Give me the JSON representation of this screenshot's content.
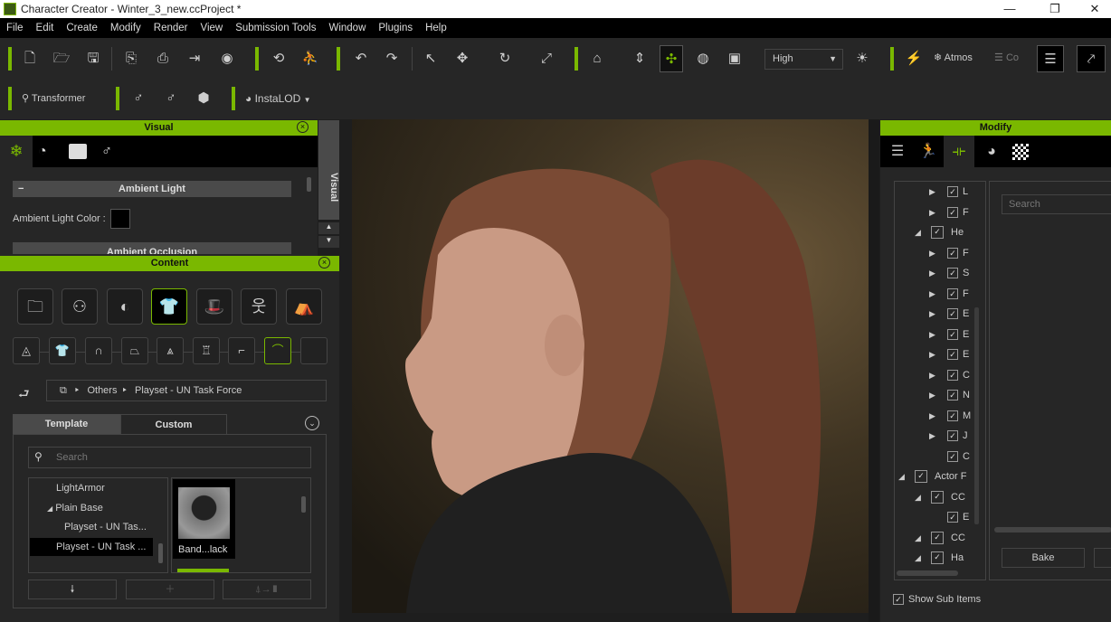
{
  "window": {
    "title": "Character Creator - Winter_3_new.ccProject *",
    "minimize": "—",
    "maximize": "❐",
    "close": "✕"
  },
  "menu": [
    "File",
    "Edit",
    "Create",
    "Modify",
    "Render",
    "View",
    "Submission Tools",
    "Window",
    "Plugins",
    "Help"
  ],
  "toolbar": {
    "quality_select": "High",
    "atmos_label": "Atmos",
    "co_label": "Co",
    "transformer_label": "Transformer",
    "instalod_label": "InstaLOD"
  },
  "colors": {
    "accent": "#7ab800",
    "panel": "#262626",
    "menubar": "#000000"
  },
  "visual_panel": {
    "title": "Visual",
    "side_tab": "Visual",
    "section1": "Ambient Light",
    "color_label": "Ambient Light Color :",
    "ambient_color": "#000000",
    "section2": "Ambient Occlusion"
  },
  "content_panel": {
    "title": "Content",
    "breadcrumb": [
      "Others",
      "Playset - UN Task Force"
    ],
    "tabs": [
      "Template",
      "Custom"
    ],
    "active_tab": "Template",
    "search_placeholder": "Search",
    "tree": [
      {
        "label": "LightArmor",
        "level": 1
      },
      {
        "label": "Plain Base",
        "level": 1,
        "expanded": true
      },
      {
        "label": "Playset - UN Tas...",
        "level": 2
      },
      {
        "label": "Playset - UN Task ...",
        "level": 1,
        "selected": true
      }
    ],
    "thumbnail_label": "Band...lack"
  },
  "modify_panel": {
    "title": "Modify",
    "search_placeholder": "Search",
    "bake_label": "Bake",
    "show_sub_items": "Show Sub Items",
    "tree": [
      {
        "label": "L",
        "level": 3
      },
      {
        "label": "F",
        "level": 3
      },
      {
        "label": "He",
        "level": 2
      },
      {
        "label": "F",
        "level": 3
      },
      {
        "label": "S",
        "level": 3
      },
      {
        "label": "F",
        "level": 3
      },
      {
        "label": "E",
        "level": 3
      },
      {
        "label": "E",
        "level": 3
      },
      {
        "label": "E",
        "level": 3
      },
      {
        "label": "C",
        "level": 3
      },
      {
        "label": "N",
        "level": 3
      },
      {
        "label": "M",
        "level": 3
      },
      {
        "label": "J",
        "level": 3
      },
      {
        "label": "C",
        "level": 3
      },
      {
        "label": "Actor F",
        "level": 1
      },
      {
        "label": "CC",
        "level": 2
      },
      {
        "label": "E",
        "level": 3
      },
      {
        "label": "CC",
        "level": 2
      },
      {
        "label": "Ha",
        "level": 2
      }
    ]
  }
}
